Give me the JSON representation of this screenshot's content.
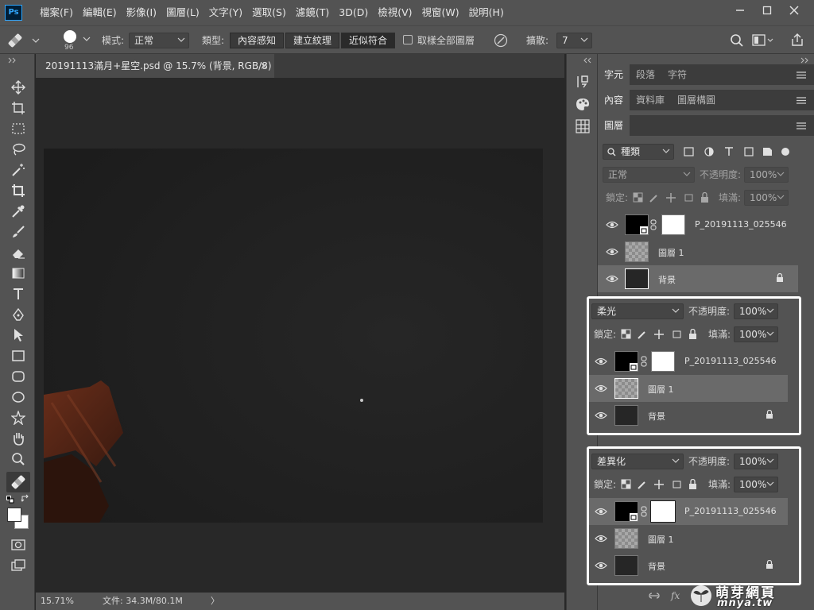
{
  "app": {
    "logo": "Ps"
  },
  "menubar": {
    "items": [
      "檔案(F)",
      "編輯(E)",
      "影像(I)",
      "圖層(L)",
      "文字(Y)",
      "選取(S)",
      "濾鏡(T)",
      "3D(D)",
      "檢視(V)",
      "視窗(W)",
      "說明(H)"
    ],
    "window_controls": [
      "minimize-icon",
      "maximize-icon",
      "close-icon"
    ]
  },
  "options": {
    "brush_size": "96",
    "mode_label": "模式:",
    "mode_value": "正常",
    "type_label": "類型:",
    "type_buttons": [
      "內容感知",
      "建立紋理",
      "近似符合"
    ],
    "sample_all_label": "取樣全部圖層",
    "diffusion_label": "擴散:",
    "diffusion_value": "7"
  },
  "document": {
    "tab_title": "20191113滿月+星空.psd @ 15.7% (背景, RGB/8)",
    "close_glyph": "×",
    "zoom": "15.71%",
    "file_info": "文件: 34.3M/80.1M",
    "status_arrow": "〉"
  },
  "panels": {
    "row1_tabs": [
      "字元",
      "段落",
      "字符"
    ],
    "row2_tabs": [
      "內容",
      "資料庫",
      "圖層構圖"
    ],
    "row3_tabs": [
      "圖層"
    ],
    "filter_kind": "種類",
    "blend_mode": "正常",
    "opacity_label": "不透明度:",
    "opacity_value": "100%",
    "lock_label": "鎖定:",
    "fill_label": "填滿:",
    "fill_value": "100%"
  },
  "layers": [
    {
      "name": "P_20191113_025546",
      "type": "smart-with-mask"
    },
    {
      "name": "圖層 1",
      "type": "transparent"
    },
    {
      "name": "背景",
      "type": "background-locked"
    }
  ],
  "inset1": {
    "blend_mode": "柔光",
    "opacity_label": "不透明度:",
    "opacity_value": "100%",
    "lock_label": "鎖定:",
    "fill_label": "填滿:",
    "fill_value": "100%",
    "selected_index": 1
  },
  "inset2": {
    "blend_mode": "差異化",
    "opacity_label": "不透明度:",
    "opacity_value": "100%",
    "lock_label": "鎖定:",
    "fill_label": "填滿:",
    "fill_value": "100%",
    "selected_index": 0
  },
  "watermark": {
    "title": "萌芽網頁",
    "url": "mnya.tw"
  },
  "colors": {
    "accent": "#31a8ff",
    "panel": "#535353",
    "dark": "#282828",
    "highlight": "#ffffff"
  }
}
